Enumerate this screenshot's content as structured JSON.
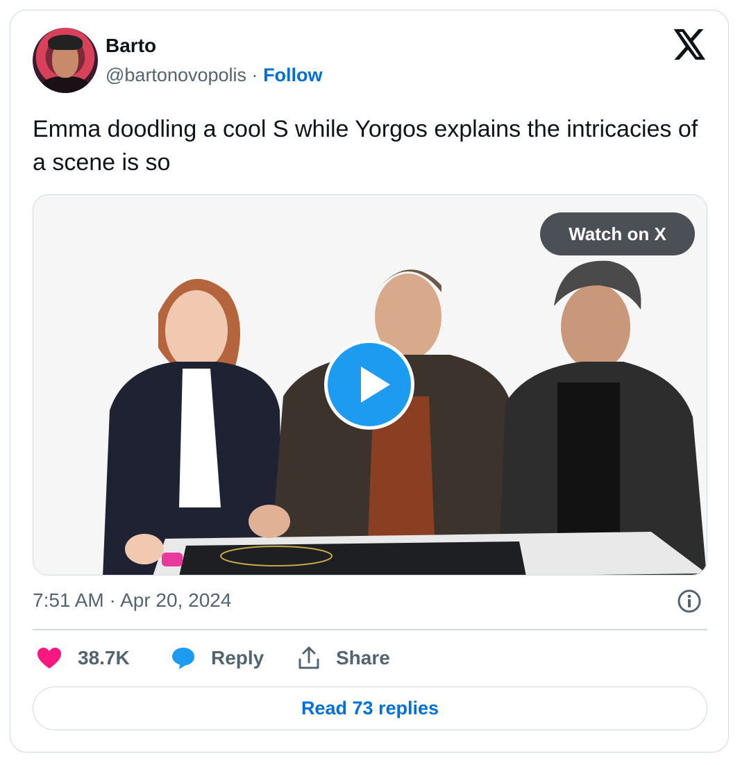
{
  "author": {
    "name": "Barto",
    "handle": "@bartonovopolis",
    "separator": "·",
    "follow_label": "Follow"
  },
  "tweet": {
    "text": "Emma doodling a cool S while Yorgos explains the intricacies of a scene is so",
    "watch_label": "Watch on X",
    "timestamp": "7:51 AM · Apr 20, 2024"
  },
  "actions": {
    "likes": "38.7K",
    "reply_label": "Reply",
    "share_label": "Share",
    "read_replies_label": "Read 73 replies"
  },
  "colors": {
    "like": "#f91880",
    "reply": "#1d9bf0",
    "link": "#006fd6",
    "play": "#1d9bf0"
  },
  "icons": [
    "x-logo-icon",
    "play-icon",
    "info-icon",
    "heart-icon",
    "reply-bubble-icon",
    "share-icon"
  ]
}
